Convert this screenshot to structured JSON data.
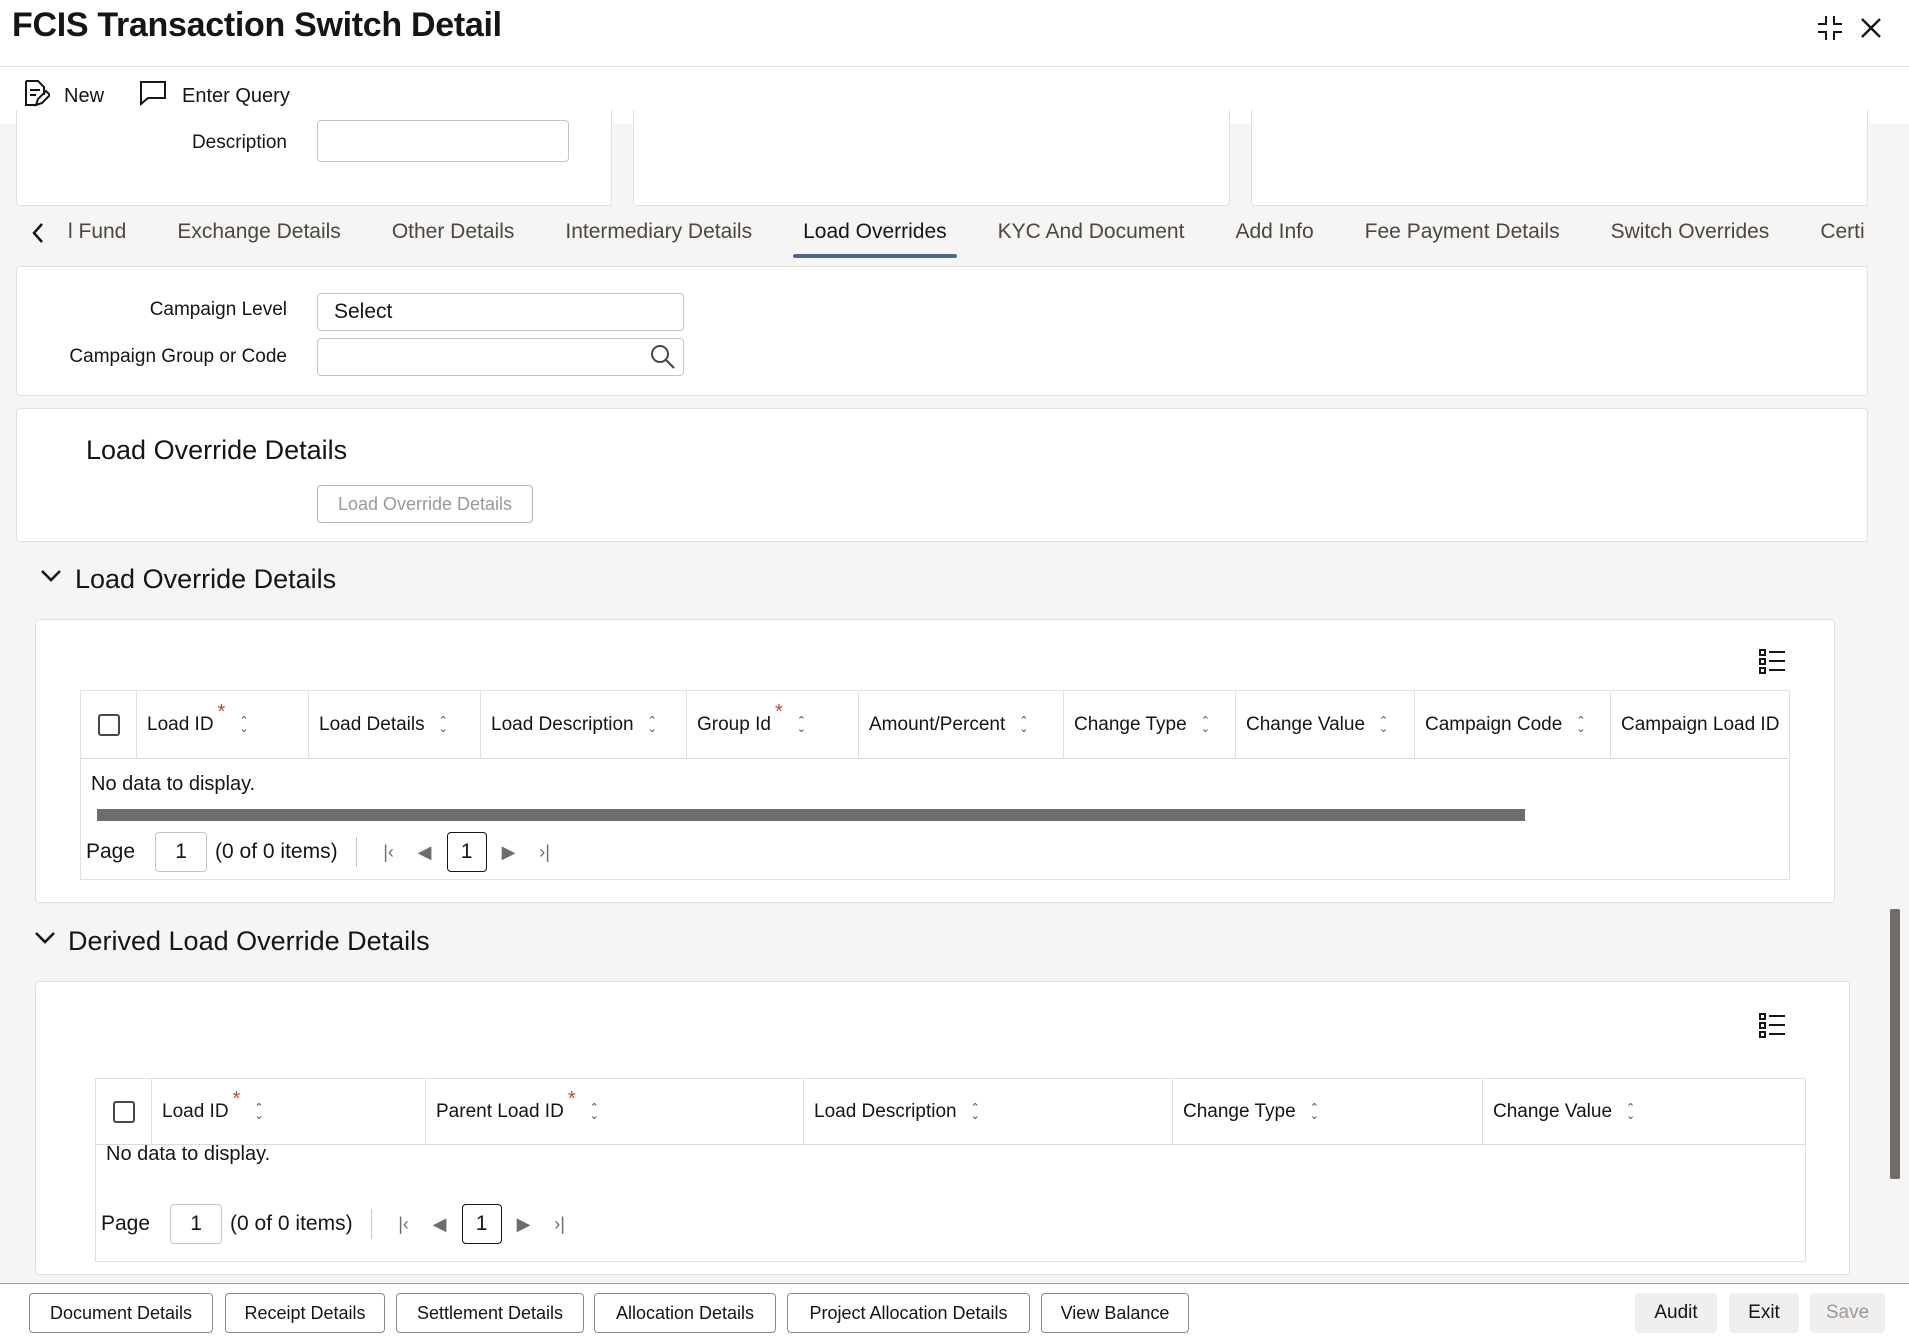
{
  "window": {
    "title": "FCIS Transaction Switch Detail"
  },
  "toolbar": {
    "new_label": "New",
    "enter_query_label": "Enter Query"
  },
  "header_fields": {
    "description_label": "Description",
    "description_value": ""
  },
  "tabs": [
    {
      "label": "l Fund"
    },
    {
      "label": "Exchange Details"
    },
    {
      "label": "Other Details"
    },
    {
      "label": "Intermediary Details"
    },
    {
      "label": "Load Overrides",
      "active": true
    },
    {
      "label": "KYC And Document"
    },
    {
      "label": "Add Info"
    },
    {
      "label": "Fee Payment Details"
    },
    {
      "label": "Switch Overrides"
    },
    {
      "label": "Certi"
    }
  ],
  "campaign": {
    "level_label": "Campaign Level",
    "level_value": "Select",
    "group_label": "Campaign Group or Code",
    "group_value": ""
  },
  "load_override_box": {
    "title": "Load Override Details",
    "button_label": "Load Override Details"
  },
  "load_override_grid": {
    "section_title": "Load Override Details",
    "columns": [
      {
        "label": "Load ID",
        "required": true
      },
      {
        "label": "Load Details",
        "required": false
      },
      {
        "label": "Load Description",
        "required": false
      },
      {
        "label": "Group Id",
        "required": true
      },
      {
        "label": "Amount/Percent",
        "required": false
      },
      {
        "label": "Change Type",
        "required": false
      },
      {
        "label": "Change Value",
        "required": false
      },
      {
        "label": "Campaign Code",
        "required": false
      },
      {
        "label": "Campaign Load ID",
        "required": false
      }
    ],
    "empty_text": "No data to display.",
    "page_label": "Page",
    "page_value": "1",
    "items_text": "(0 of 0 items)",
    "current_page": "1"
  },
  "derived_grid": {
    "section_title": "Derived Load Override Details",
    "columns": [
      {
        "label": "Load ID",
        "required": true
      },
      {
        "label": "Parent Load ID",
        "required": true
      },
      {
        "label": "Load Description",
        "required": false
      },
      {
        "label": "Change Type",
        "required": false
      },
      {
        "label": "Change Value",
        "required": false
      }
    ],
    "empty_text": "No data to display.",
    "page_label": "Page",
    "page_value": "1",
    "items_text": "(0 of 0 items)",
    "current_page": "1"
  },
  "footer": {
    "document_details": "Document Details",
    "receipt_details": "Receipt Details",
    "settlement_details": "Settlement Details",
    "allocation_details": "Allocation Details",
    "project_allocation_details": "Project Allocation Details",
    "view_balance": "View Balance",
    "audit": "Audit",
    "exit": "Exit",
    "save": "Save"
  },
  "colors": {
    "accent": "#4b6a8a",
    "required": "#c74634",
    "text": "#161513"
  }
}
